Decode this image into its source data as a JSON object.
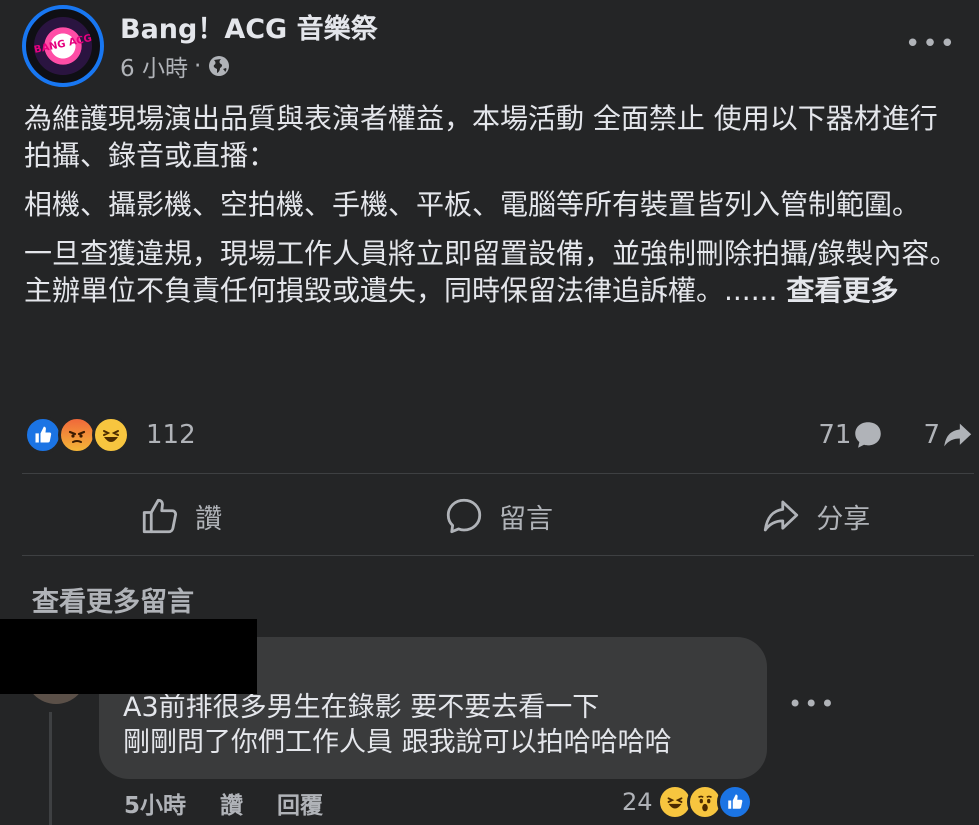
{
  "post": {
    "page_name": "Bang！ACG 音樂祭",
    "timestamp": "6 小時",
    "separator": "·",
    "audience_icon": "globe-icon",
    "more_menu": "•••",
    "avatar_logo_text": "BANG ACG",
    "paragraphs": [
      "為維護現場演出品質與表演者權益，本場活動 全面禁止 使用以下器材進行拍攝、錄音或直播：",
      "相機、攝影機、空拍機、手機、平板、電腦等所有裝置皆列入管制範圍。",
      "一旦查獲違規，現場工作人員將立即留置設備，並強制刪除拍攝/錄製內容。主辦單位不負責任何損毀或遺失，同時保留法律追訴權。...... "
    ],
    "see_more": "查看更多"
  },
  "reactions": {
    "icons": [
      "like-reaction",
      "angry-reaction",
      "haha-reaction"
    ],
    "count": "112",
    "comments_count": "71",
    "shares_count": "7"
  },
  "actions": {
    "like_label": "讚",
    "comment_label": "留言",
    "share_label": "分享"
  },
  "comments": {
    "view_more": "查看更多留言",
    "items": [
      {
        "line1": "A3前排很多男生在錄影 要不要去看一下",
        "line2": "剛剛問了你們工作人員 跟我說可以拍哈哈哈哈",
        "time": "5小時",
        "like": "讚",
        "reply": "回覆",
        "reaction_count": "24",
        "more_menu": "•••"
      }
    ]
  },
  "colors": {
    "background": "#242526",
    "bubble": "#3a3b3c",
    "text_primary": "#e4e6eb",
    "text_secondary": "#b0b3b8",
    "accent": "#1877f2"
  }
}
